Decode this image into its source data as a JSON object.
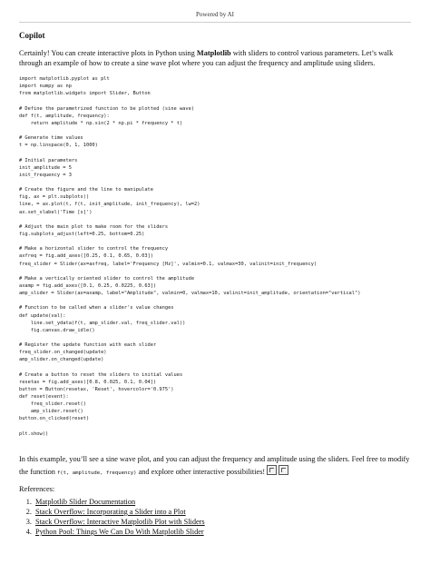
{
  "header": {
    "powered_by": "Powered by AI"
  },
  "title": "Copilot",
  "intro": {
    "part1": "Certainly! You can create interactive plots in Python using ",
    "bold": "Matplotlib",
    "part2": " with sliders to control various parameters. Let’s walk through an example of how to create a sine wave plot where you can adjust the frequency and amplitude using sliders."
  },
  "code_lines": [
    "import matplotlib.pyplot as plt",
    "import numpy as np",
    "from matplotlib.widgets import Slider, Button",
    "",
    "# Define the parametrized function to be plotted (sine wave)",
    "def f(t, amplitude, frequency):",
    "    return amplitude * np.sin(2 * np.pi * frequency * t)",
    "",
    "# Generate time values",
    "t = np.linspace(0, 1, 1000)",
    "",
    "# Initial parameters",
    "init_amplitude = 5",
    "init_frequency = 3",
    "",
    "# Create the figure and the line to manipulate",
    "fig, ax = plt.subplots()",
    "line, = ax.plot(t, f(t, init_amplitude, init_frequency), lw=2)",
    "ax.set_xlabel('Time [s]')",
    "",
    "# Adjust the main plot to make room for the sliders",
    "fig.subplots_adjust(left=0.25, bottom=0.25)",
    "",
    "# Make a horizontal slider to control the frequency",
    "axfreq = fig.add_axes([0.25, 0.1, 0.65, 0.03])",
    "freq_slider = Slider(ax=axfreq, label='Frequency [Hz]', valmin=0.1, valmax=30, valinit=init_frequency)",
    "",
    "# Make a vertically oriented slider to control the amplitude",
    "axamp = fig.add_axes([0.1, 0.25, 0.0225, 0.63])",
    "amp_slider = Slider(ax=axamp, label=\"Amplitude\", valmin=0, valmax=10, valinit=init_amplitude, orientation=\"vertical\")",
    "",
    "# Function to be called when a slider's value changes",
    "def update(val):",
    "    line.set_ydata(f(t, amp_slider.val, freq_slider.val))",
    "    fig.canvas.draw_idle()",
    "",
    "# Register the update function with each slider",
    "freq_slider.on_changed(update)",
    "amp_slider.on_changed(update)",
    "",
    "# Create a button to reset the sliders to initial values",
    "resetax = fig.add_axes([0.8, 0.025, 0.1, 0.04])",
    "button = Button(resetax, 'Reset', hovercolor='0.975')",
    "def reset(event):",
    "    freq_slider.reset()",
    "    amp_slider.reset()",
    "button.on_clicked(reset)",
    "",
    "plt.show()"
  ],
  "outro": {
    "part1": "In this example, you’ll see a sine wave plot, and you can adjust the frequency and amplitude using the sliders. Feel free to modify the function ",
    "code": "f(t, amplitude, frequency)",
    "part2": " and explore other interactive possibilities!",
    "emoji_icons": [
      "chart-emoji-icon",
      "slider-emoji-icon"
    ]
  },
  "references": {
    "heading": "References:",
    "items": [
      "Matplotlib Slider Documentation",
      "Stack Overflow: Incorporating a Slider into a Plot",
      "Stack Overflow: Interactive Matplotlib Plot with Sliders",
      "Python Pool: Things We Can Do With Matplotlib Slider"
    ]
  }
}
